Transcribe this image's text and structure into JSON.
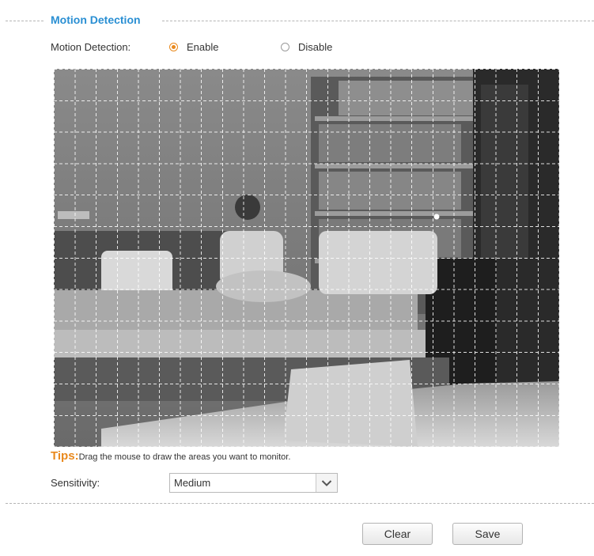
{
  "section": {
    "title": "Motion Detection"
  },
  "motion": {
    "label": "Motion Detection:",
    "options": [
      {
        "label": "Enable",
        "checked": true
      },
      {
        "label": "Disable",
        "checked": false
      }
    ]
  },
  "tips": {
    "label": "Tips:",
    "text": "Drag the mouse to draw the areas you want to monitor."
  },
  "sensitivity": {
    "label": "Sensitivity:",
    "value": "Medium"
  },
  "buttons": {
    "clear": "Clear",
    "save": "Save"
  },
  "colors": {
    "accent": "#e9891d",
    "title": "#2a8fd3"
  },
  "icons": {
    "dropdown": "chevron-down-icon"
  }
}
